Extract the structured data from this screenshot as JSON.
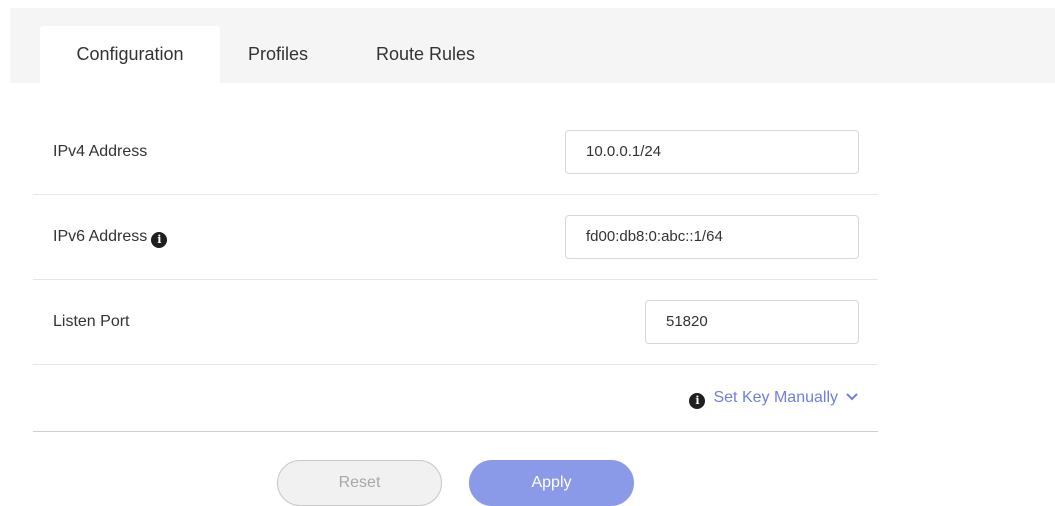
{
  "tabs": [
    {
      "label": "Configuration",
      "active": true
    },
    {
      "label": "Profiles",
      "active": false
    },
    {
      "label": "Route Rules",
      "active": false
    }
  ],
  "form": {
    "ipv4": {
      "label": "IPv4 Address",
      "value": "10.0.0.1/24"
    },
    "ipv6": {
      "label": "IPv6 Address",
      "value": "fd00:db8:0:abc::1/64",
      "has_info_icon": true
    },
    "port": {
      "label": "Listen Port",
      "value": "51820"
    },
    "set_key": {
      "label": "Set Key Manually",
      "icon": "info-icon",
      "expand_icon": "chevron-down-icon"
    }
  },
  "buttons": {
    "reset": "Reset",
    "apply": "Apply"
  },
  "colors": {
    "accent": "#6f7fe0",
    "apply_button": "#8b9ae8",
    "tabbar_bg": "#f5f5f5"
  }
}
